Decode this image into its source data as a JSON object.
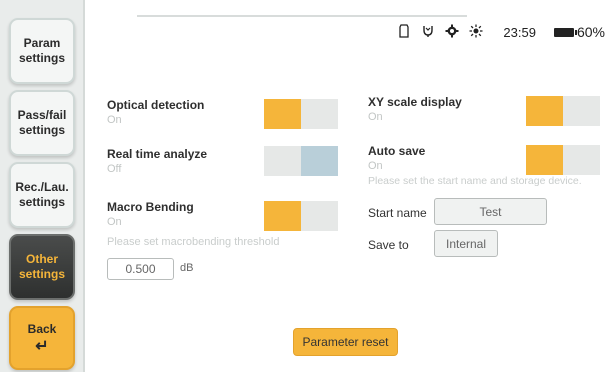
{
  "sidebar": {
    "items": [
      {
        "line1": "Param",
        "line2": "settings"
      },
      {
        "line1": "Pass/fail",
        "line2": "settings"
      },
      {
        "line1": "Rec./Lau.",
        "line2": "settings"
      },
      {
        "line1": "Other",
        "line2": "settings",
        "active": true
      },
      {
        "line1": "Back",
        "arrow": "↵"
      }
    ]
  },
  "status_bar": {
    "icons": [
      "sd-card-icon",
      "usb-icon",
      "gear-icon",
      "brightness-icon"
    ],
    "time": "23:59",
    "battery_percent": "60%"
  },
  "left_settings": {
    "optical_detection": {
      "label": "Optical detection",
      "state": "On",
      "on": true
    },
    "real_time_analyze": {
      "label": "Real time analyze",
      "state": "Off",
      "on": false
    },
    "macro_bending": {
      "label": "Macro Bending",
      "state": "On",
      "on": true
    },
    "macro_hint": "Please set macrobending threshold",
    "threshold_value": "0.500",
    "threshold_unit": "dB"
  },
  "right_settings": {
    "xy_scale_display": {
      "label": "XY scale display",
      "state": "On",
      "on": true
    },
    "auto_save": {
      "label": "Auto save",
      "state": "On",
      "on": true
    },
    "auto_save_hint": "Please set the start name and storage device.",
    "start_name_label": "Start name",
    "start_name_value": "Test",
    "save_to_label": "Save to",
    "save_to_value": "Internal"
  },
  "footer": {
    "reset_label": "Parameter reset"
  },
  "colors": {
    "accent": "#f5b53a",
    "toggle_off_fill": "#b9cfd9"
  }
}
